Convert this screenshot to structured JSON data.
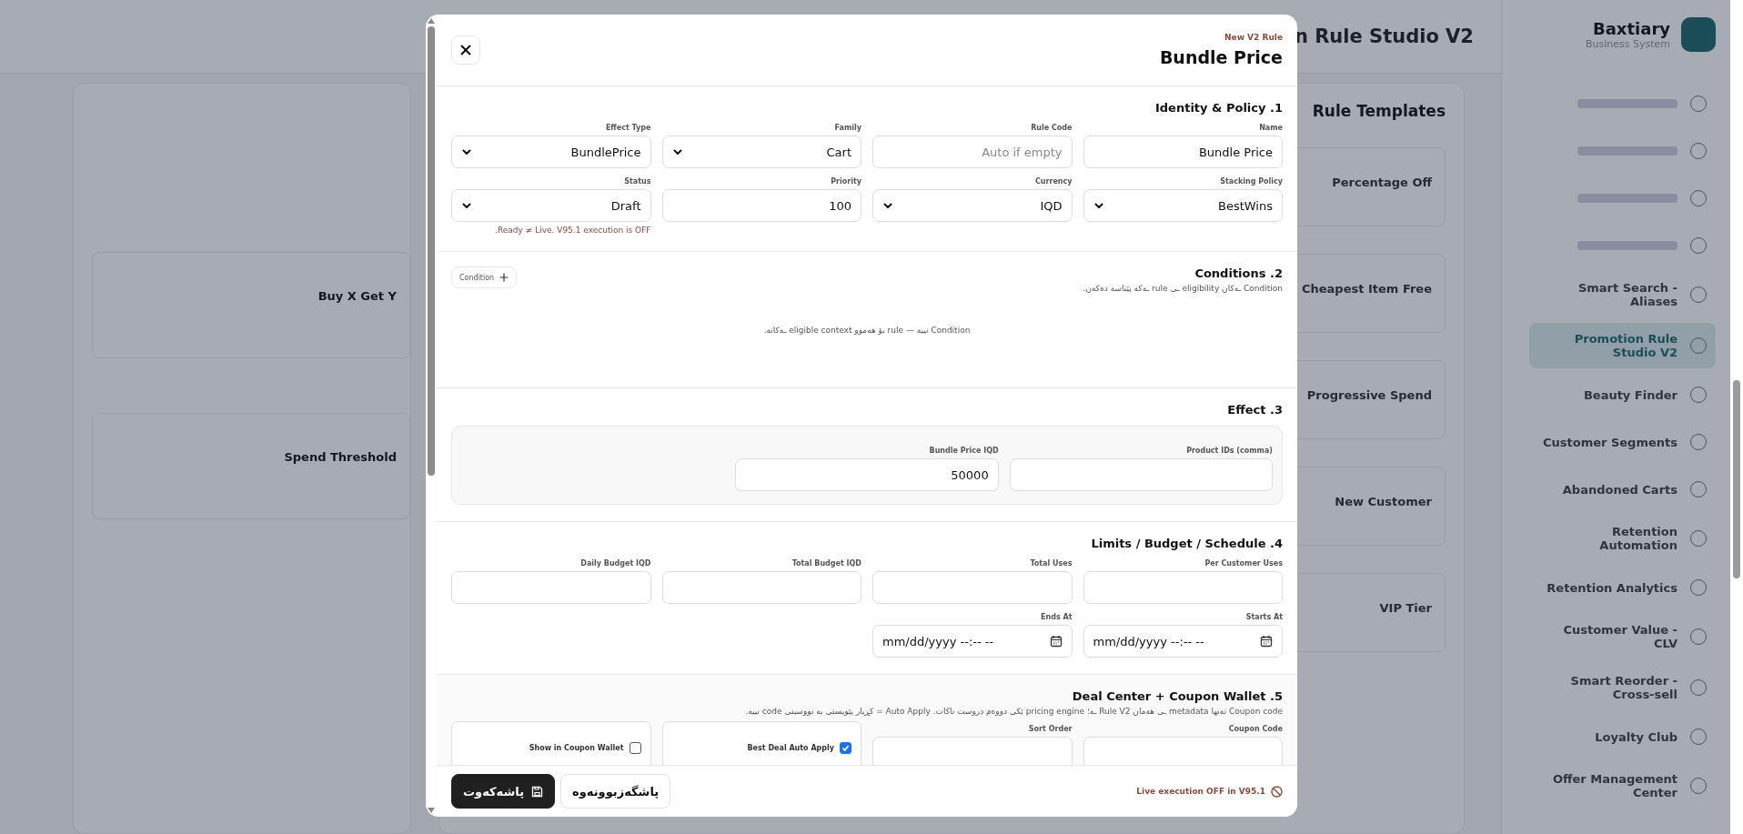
{
  "backdrop": {
    "brand": {
      "name": "Baxtiary",
      "subtitle": "Business System"
    },
    "page_title": "n Rule Studio V2",
    "sidebar": {
      "items": [
        {
          "label": "Smart Search - Aliases",
          "selected": false
        },
        {
          "label": "Promotion Rule Studio V2",
          "selected": true
        },
        {
          "label": "Beauty Finder",
          "selected": false
        },
        {
          "label": "Customer Segments",
          "selected": false
        },
        {
          "label": "Abandoned Carts",
          "selected": false
        },
        {
          "label": "Retention Automation",
          "selected": false
        },
        {
          "label": "Retention Analytics",
          "selected": false
        },
        {
          "label": "Customer Value - CLV",
          "selected": false
        },
        {
          "label": "Smart Reorder - Cross-sell",
          "selected": false
        },
        {
          "label": "Loyalty Club",
          "selected": false
        },
        {
          "label": "Offer Management Center",
          "selected": false
        }
      ]
    },
    "templates_panel": {
      "title": "Rule Templates",
      "cards": [
        {
          "title": "Percentage Off"
        },
        {
          "title": "Cheapest Item Free"
        },
        {
          "title": "Progressive Spend"
        },
        {
          "title": "New Customer"
        },
        {
          "title": "VIP Tier"
        }
      ]
    },
    "left_cards": [
      {
        "title": "Buy X Get Y"
      },
      {
        "title": "Spend Threshold"
      }
    ]
  },
  "modal": {
    "eyebrow": "New V2 Rule",
    "title": "Bundle Price",
    "sections": [
      {
        "title": "1. Identity & Policy",
        "rows": [
          {
            "fields": [
              {
                "kind": "select",
                "label": "Effect Type",
                "value": "BundlePrice"
              },
              {
                "kind": "select",
                "label": "Family",
                "value": "Cart"
              },
              {
                "kind": "input",
                "label": "Rule Code",
                "placeholder": "Auto if empty"
              },
              {
                "kind": "input",
                "label": "Name",
                "value": "Bundle Price"
              }
            ]
          },
          {
            "fields": [
              {
                "kind": "select",
                "label": "Status",
                "value": "Draft",
                "note": "Ready ≠ Live. V95.1 execution is OFF."
              },
              {
                "kind": "input",
                "label": "Priority",
                "value": "100"
              },
              {
                "kind": "select",
                "label": "Currency",
                "value": "IQD"
              },
              {
                "kind": "select",
                "label": "Stacking Policy",
                "value": "BestWins"
              }
            ]
          }
        ]
      },
      {
        "title": "2. Conditions",
        "description": "Condition ـەکان eligibility ـی rule ـەکە پێناسە دەکەن.",
        "add_button": "Condition",
        "empty_text": "Condition نییە — rule بۆ هەموو eligible context ـەکانە."
      },
      {
        "title": "3. Effect",
        "boxed": true,
        "rows": [
          {
            "fields": [
              {
                "kind": "input",
                "label": "Bundle Price IQD",
                "value": "50000"
              },
              {
                "kind": "input",
                "label": "Product IDs (comma)"
              }
            ]
          }
        ]
      },
      {
        "title": "4. Limits / Budget / Schedule",
        "rows": [
          {
            "fields": [
              {
                "kind": "input",
                "label": "Daily Budget IQD"
              },
              {
                "kind": "input",
                "label": "Total Budget IQD"
              },
              {
                "kind": "input",
                "label": "Total Uses"
              },
              {
                "kind": "input",
                "label": "Per Customer Uses"
              }
            ]
          },
          {
            "fields": [
              {
                "kind": "date",
                "label": "Ends At",
                "value": "mm/dd/yyyy --:-- --"
              },
              {
                "kind": "date",
                "label": "Starts At",
                "value": "mm/dd/yyyy --:-- --"
              }
            ]
          }
        ]
      },
      {
        "title": "5. Deal Center + Coupon Wallet",
        "shaded": true,
        "description": "Coupon code تەنها metadata ـی هەمان Rule V2 ـە؛ pricing engine ێکی دووەم دروست ناکات. Auto Apply = کڕیار پێویستی بە نووسینی code نییە.",
        "rows": [
          {
            "fields": [
              {
                "kind": "checkbox",
                "label": "Show in Coupon Wallet",
                "checked": false
              },
              {
                "kind": "checkbox",
                "label": "Best Deal Auto Apply",
                "checked": true
              },
              {
                "kind": "input",
                "label": "Sort Order"
              },
              {
                "kind": "input",
                "label": "Coupon Code"
              }
            ]
          }
        ]
      }
    ],
    "footer": {
      "status": "Live execution OFF in V95.1",
      "buttons": [
        {
          "kind": "secondary",
          "label": "پاشگەزبوونەوە"
        },
        {
          "kind": "primary",
          "label": "پاشەکەوت"
        }
      ]
    }
  }
}
